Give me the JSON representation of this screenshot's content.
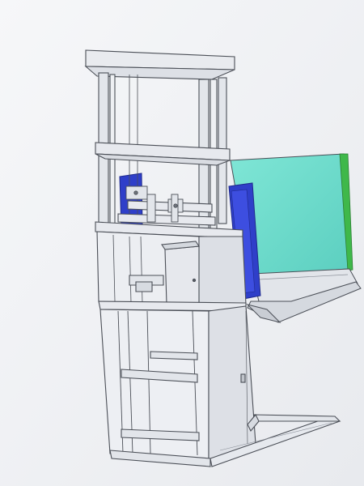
{
  "caption": {
    "text": "",
    "visible": false
  },
  "scene": {
    "subject": "vertical-lift-cad-drawing",
    "colors": {
      "background": "#f3f4f6",
      "frame_line": "#4b4f57",
      "frame_fill": "#e7e9ee",
      "panel_fill": "#dde0e6",
      "carriage_blue": "#2f3fc9",
      "carriage_blue_dark": "#1f2a8d",
      "platform_cyan": "#6cdcc8",
      "platform_cyan_dark": "#47b6a8",
      "platform_edge_green": "#3fb84a",
      "ramp_fill": "#d9dce2"
    }
  }
}
